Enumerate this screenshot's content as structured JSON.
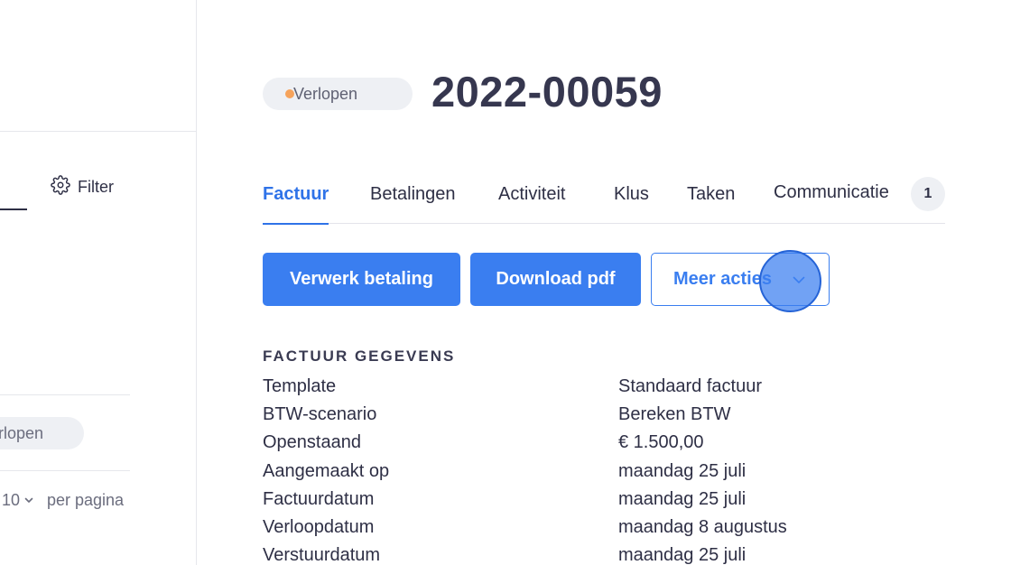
{
  "sidebar": {
    "filter_label": "Filter",
    "chip_label": "rlopen",
    "page_size": "10",
    "per_page_label": "per pagina"
  },
  "header": {
    "status": "Verlopen",
    "status_color": "#f6a35b",
    "title": "2022-00059"
  },
  "tabs": [
    {
      "label": "Factuur",
      "active": true
    },
    {
      "label": "Betalingen",
      "active": false
    },
    {
      "label": "Activiteit",
      "active": false
    },
    {
      "label": "Klus",
      "active": false
    },
    {
      "label": "Taken",
      "active": false
    },
    {
      "label": "Communicatie",
      "active": false,
      "count": "1"
    }
  ],
  "actions": {
    "process_payment": "Verwerk betaling",
    "download_pdf": "Download pdf",
    "more_actions": "Meer acties"
  },
  "details": {
    "section_title": "FACTUUR GEGEVENS",
    "rows": [
      {
        "label": "Template",
        "value": "Standaard factuur"
      },
      {
        "label": "BTW-scenario",
        "value": "Bereken BTW"
      },
      {
        "label": "Openstaand",
        "value": "€ 1.500,00"
      },
      {
        "label": "Aangemaakt op",
        "value": "maandag 25 juli"
      },
      {
        "label": "Factuurdatum",
        "value": "maandag 25 juli"
      },
      {
        "label": "Verloopdatum",
        "value": "maandag 8 augustus"
      },
      {
        "label": "Verstuurdatum",
        "value": "maandag 25 juli"
      }
    ]
  },
  "colors": {
    "accent": "#3a7ef0",
    "text": "#2e2f45"
  }
}
